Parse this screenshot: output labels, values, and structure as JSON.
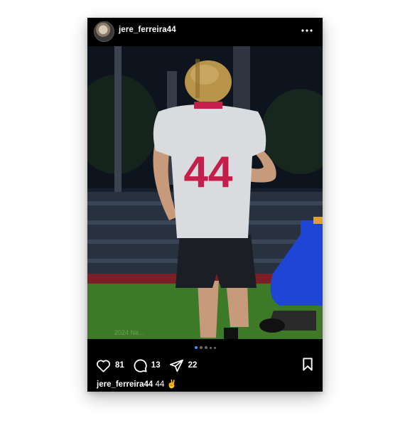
{
  "post": {
    "username": "jere_ferreira44",
    "jersey_number": "44",
    "likes": "81",
    "comments": "13",
    "shares": "22",
    "caption_text": "44 ✌️",
    "carousel": {
      "total": 5,
      "active": 1
    }
  },
  "colors": {
    "background": "#000000",
    "text": "#ffffff",
    "active_dot": "#3897f0",
    "jersey_number": "#c41e4a"
  },
  "icons": {
    "menu": "more-horizontal-icon",
    "like": "heart-icon",
    "comment": "comment-bubble-icon",
    "share": "paper-plane-icon",
    "save": "bookmark-icon"
  }
}
